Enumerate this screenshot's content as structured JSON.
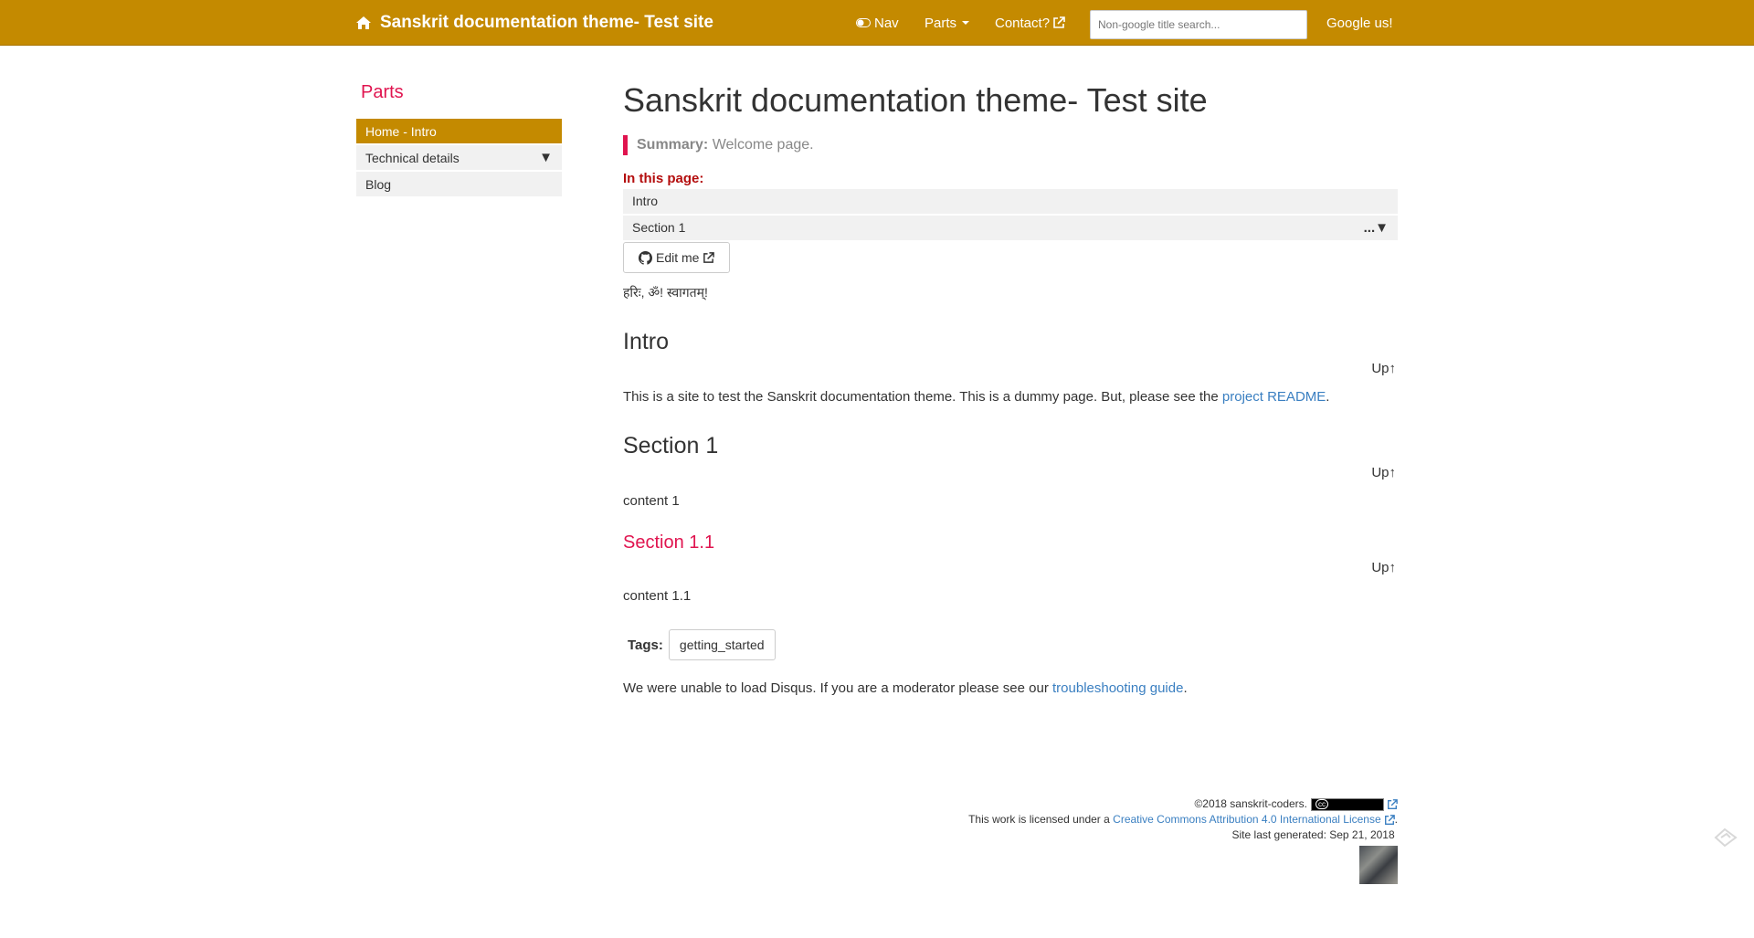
{
  "navbar": {
    "brand": "Sanskrit documentation theme- Test site",
    "nav_label": "Nav",
    "parts_label": "Parts",
    "contact_label": "Contact?",
    "search_placeholder": "Non-google title search...",
    "google_label": "Google us!"
  },
  "sidebar": {
    "title": "Parts",
    "items": [
      {
        "label": "Home - Intro"
      },
      {
        "label": "Technical details",
        "arrow": "▼"
      },
      {
        "label": "Blog"
      }
    ]
  },
  "main": {
    "title": "Sanskrit documentation theme- Test site",
    "summary_label": "Summary:",
    "summary_text": "Welcome page.",
    "toc_label": "In this page:",
    "toc": [
      {
        "label": "Intro"
      },
      {
        "label": "Section 1",
        "more": "...▼"
      }
    ],
    "edit_label": "Edit me",
    "sanskrit_line": "हरिः, ॐ! स्वागतम्!",
    "up_label": "Up↑",
    "intro_heading": "Intro",
    "intro_text": "This is a site to test the Sanskrit documentation theme. This is a dummy page. But, please see the",
    "intro_link": "project README",
    "intro_end": ".",
    "section1_heading": "Section 1",
    "section1_text": "content 1",
    "section11_heading": "Section 1.1",
    "section11_text": "content 1.1",
    "tags_label": "Tags:",
    "tags": [
      "getting_started"
    ],
    "disqus_text": "We were unable to load Disqus. If you are a moderator please see our",
    "disqus_link": "troubleshooting guide",
    "disqus_end": "."
  },
  "footer": {
    "copyright": "©2018 sanskrit-coders.",
    "license_prefix": "This work is licensed under a",
    "license_link": "Creative Commons Attribution 4.0 International License",
    "license_end": ".",
    "generated": "Site last generated: Sep 21, 2018"
  }
}
